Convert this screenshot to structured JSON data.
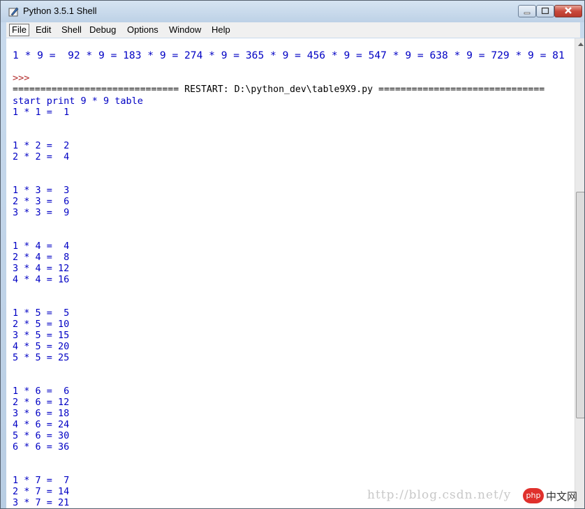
{
  "window": {
    "title": "Python 3.5.1 Shell",
    "accent": "#0000c4",
    "prompt_color": "#b32d2d"
  },
  "menu": [
    "File",
    "Edit",
    "Shell",
    "Debug",
    "Options",
    "Window",
    "Help"
  ],
  "shell": {
    "row9": "1 * 9 =  92 * 9 = 183 * 9 = 274 * 9 = 365 * 9 = 456 * 9 = 547 * 9 = 638 * 9 = 729 * 9 = 81",
    "prompt": ">>>",
    "restart": "============================== RESTART: D:\\python_dev\\table9X9.py ==============================",
    "start": "start print 9 * 9 table",
    "blocks": [
      [
        "1 * 1 =  1"
      ],
      [
        "1 * 2 =  2",
        "2 * 2 =  4"
      ],
      [
        "1 * 3 =  3",
        "2 * 3 =  6",
        "3 * 3 =  9"
      ],
      [
        "1 * 4 =  4",
        "2 * 4 =  8",
        "3 * 4 = 12",
        "4 * 4 = 16"
      ],
      [
        "1 * 5 =  5",
        "2 * 5 = 10",
        "3 * 5 = 15",
        "4 * 5 = 20",
        "5 * 5 = 25"
      ],
      [
        "1 * 6 =  6",
        "2 * 6 = 12",
        "3 * 6 = 18",
        "4 * 6 = 24",
        "5 * 6 = 30",
        "6 * 6 = 36"
      ],
      [
        "1 * 7 =  7",
        "2 * 7 = 14",
        "3 * 7 = 21"
      ]
    ]
  },
  "watermark": {
    "url": "http://blog.csdn.net/y",
    "logo": "php",
    "logo_text": "中文网"
  }
}
